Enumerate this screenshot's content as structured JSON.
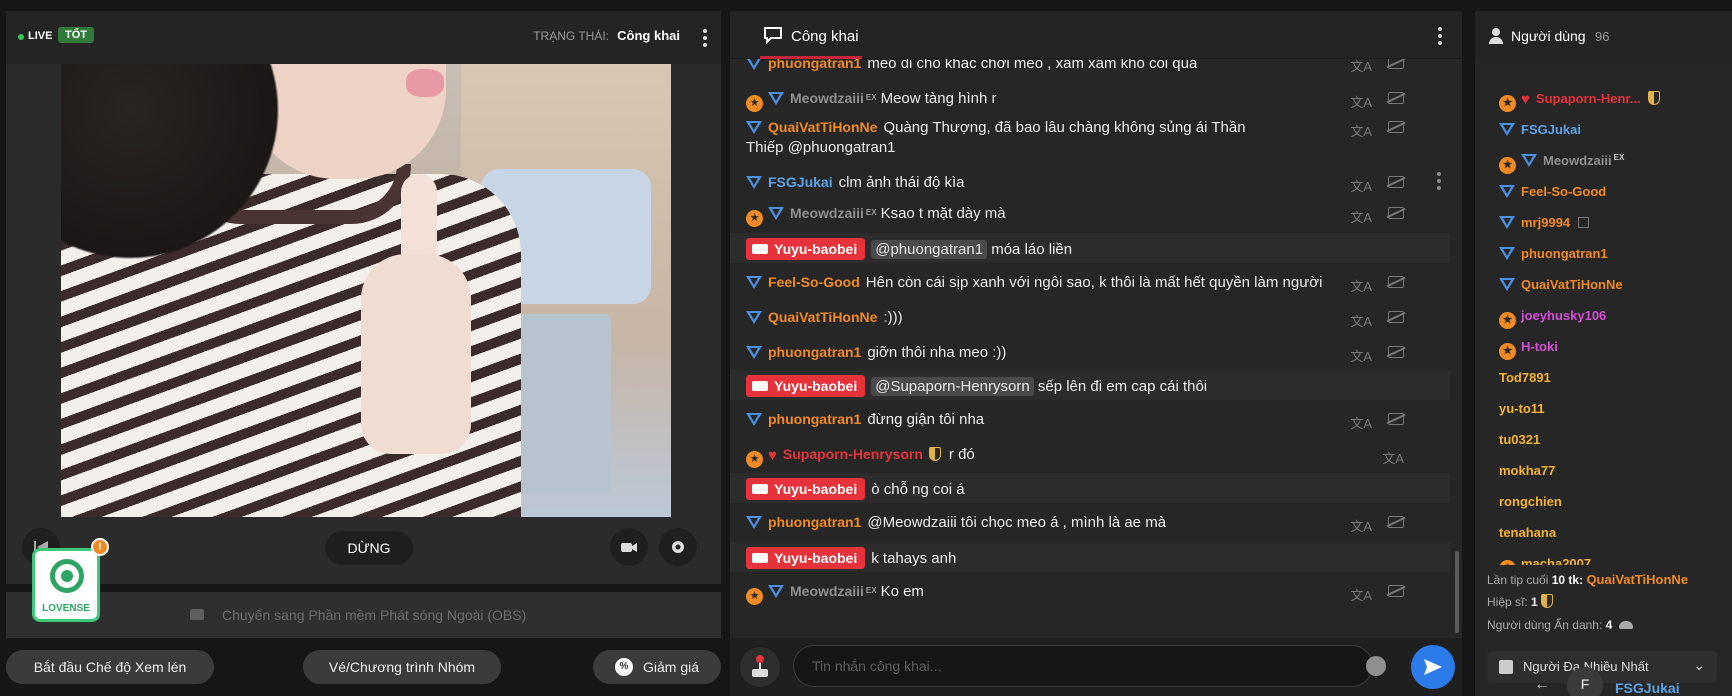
{
  "stream": {
    "live_label": "LIVE",
    "quality": "TỐT",
    "status_label": "TRẠNG THÁI:",
    "status_value": "Công khai",
    "stop_button": "DỪNG",
    "lovense_label": "LOVENSE",
    "lovense_badge": "!",
    "obs_text": "Chuyển sang Phần mềm Phát sóng Ngoài (OBS)"
  },
  "bottom_buttons": {
    "peek_mode": "Bắt đầu Chế độ Xem lén",
    "group_show": "Vé/Chương trình Nhóm",
    "discount": "Giảm giá",
    "discount_icon": "%"
  },
  "chat": {
    "title": "Công khai",
    "input_placeholder": "Tin nhắn công khai...",
    "messages": [
      {
        "user": "phuongatran1",
        "text": "meo đi chỗ khác chơi meo , xấm xấm khó coi quá"
      },
      {
        "user": "Meowdzaiii",
        "ex": "EX",
        "text": "Meow tàng hình r"
      },
      {
        "user": "QuaiVatTiHonNe",
        "text": "Quàng Thượng, đã bao lâu chàng không sủng ái Thần Thiếp @phuongatran1"
      },
      {
        "user": "FSGJukai",
        "text": "clm ảnh thái độ kìa"
      },
      {
        "user": "Meowdzaiii",
        "ex": "EX",
        "text": "Ksao t mặt dày mà"
      },
      {
        "user": "Yuyu-baobei",
        "mention": "@phuongatran1",
        "text": "móa láo liền"
      },
      {
        "user": "Feel-So-Good",
        "text": "Hên còn cái sịp xanh với ngôi sao, k thôi là mất hết quyền làm người"
      },
      {
        "user": "QuaiVatTiHonNe",
        "text": ":)))"
      },
      {
        "user": "phuongatran1",
        "text": "giỡn thôi nha meo :))"
      },
      {
        "user": "Yuyu-baobei",
        "mention": "@Supaporn-Henrysorn",
        "text": "sếp lên đi em cap cái thôi"
      },
      {
        "user": "phuongatran1",
        "text": "đừng giận tôi nha"
      },
      {
        "user": "Supaporn-Henrysorn",
        "text": "r đó"
      },
      {
        "user": "Yuyu-baobei",
        "text": "ò chỗ ng coi á"
      },
      {
        "user": "phuongatran1",
        "text": "@Meowdzaiii  tôi chọc meo á , mình là ae mà"
      },
      {
        "user": "Yuyu-baobei",
        "text": "k tahays anh"
      },
      {
        "user": "Meowdzaiii",
        "ex": "EX",
        "text": "Ko em"
      }
    ]
  },
  "users": {
    "title": "Người dùng",
    "count": "96",
    "list": [
      "Supaporn-Henr...",
      "FSGJukai",
      "Meowdzaiii",
      "Feel-So-Good",
      "mrj9994",
      "phuongatran1",
      "QuaiVatTiHonNe",
      "joeyhusky106",
      "H-toki",
      "Tod7891",
      "yu-to11",
      "tu0321",
      "mokha77",
      "rongchien",
      "tenahana",
      "macha2007"
    ],
    "last_tip_label": "Lần tip cuối",
    "last_tip_amount": "10 tk:",
    "last_tip_user": "QuaiVatTiHonNe",
    "knights_label": "Hiệp sĩ:",
    "knights_value": "1",
    "anon_label": "Người dùng Ẩn danh:",
    "anon_value": "4",
    "bottom_tab": "Người Đa Nhiều Nhất",
    "current_user_initial": "F",
    "current_user": "FSGJukai"
  },
  "colors": {
    "accent_red": "#e5323b",
    "accent_blue": "#2b7bea",
    "user_orange": "#f08a24",
    "user_blue": "#5aa3e6",
    "user_pink": "#d44fd6",
    "user_yellow": "#f2b233",
    "live_green": "#35c759"
  }
}
